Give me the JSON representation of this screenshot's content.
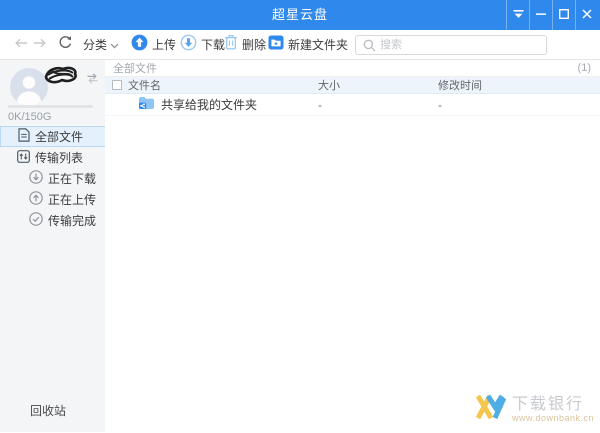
{
  "titlebar": {
    "title": "超星云盘"
  },
  "toolbar": {
    "category_label": "分类",
    "upload_label": "上传",
    "download_label": "下载",
    "delete_label": "删除",
    "new_folder_label": "新建文件夹",
    "search_placeholder": "搜索"
  },
  "sidebar": {
    "storage_usage": "0K/150G",
    "items": [
      {
        "label": "全部文件",
        "selected": true
      },
      {
        "label": "传输列表",
        "selected": false
      },
      {
        "label": "正在下载",
        "selected": false
      },
      {
        "label": "正在上传",
        "selected": false
      },
      {
        "label": "传输完成",
        "selected": false
      }
    ],
    "recycle_bin_label": "回收站"
  },
  "main": {
    "breadcrumb": "全部文件",
    "item_count": "(1)",
    "table": {
      "columns": [
        "文件名",
        "大小",
        "修改时间"
      ],
      "rows": [
        {
          "name": "共享给我的文件夹",
          "size": "-",
          "modified": "-"
        }
      ]
    }
  },
  "watermark": {
    "name": "下载银行",
    "url": "www.downbank.cn"
  },
  "colors": {
    "titlebar_blue": "#2f88ec",
    "accent_blue": "#2f88ec",
    "light_icon_blue": "#9cc9f4",
    "sidebar_bg": "#f3f5f7",
    "selected_bg": "#e4f0fc",
    "selected_border": "#b9d8f3",
    "table_header_bg": "#eef4fb",
    "watermark_yellow": "#f6c244",
    "watermark_blue": "#46a9e4"
  }
}
